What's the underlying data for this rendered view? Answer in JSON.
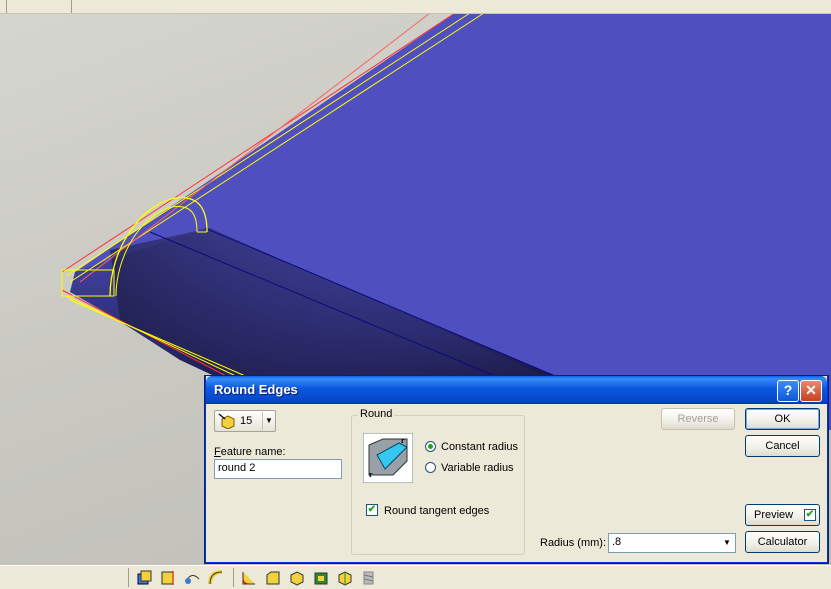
{
  "dialog": {
    "title": "Round Edges",
    "help_icon": "question-icon",
    "close_icon": "close-icon",
    "edge_count": "15",
    "feature_name_label": "Feature name:",
    "feature_name_value": "round 2",
    "group_label": "Round",
    "constant_radius_label": "Constant radius",
    "variable_radius_label": "Variable radius",
    "radius_mode_selected": "constant",
    "round_tangent_label": "Round tangent edges",
    "round_tangent_checked": true,
    "reverse_label": "Reverse",
    "ok_label": "OK",
    "cancel_label": "Cancel",
    "preview_label": "Preview",
    "preview_checked": true,
    "calculator_label": "Calculator",
    "radius_label": "Radius (mm):",
    "radius_value": ".8"
  },
  "toolbar": {
    "icons": [
      "extrude-icon",
      "revolve-icon",
      "sweep-icon",
      "loft-icon",
      "round-icon",
      "chamfer-icon",
      "shell-icon",
      "draft-icon",
      "rib-icon",
      "thread-icon"
    ]
  },
  "colors": {
    "part_face": "#4f4fbf",
    "highlight_edge": "#ffff00",
    "dialog_title": "#0a5fe6"
  }
}
